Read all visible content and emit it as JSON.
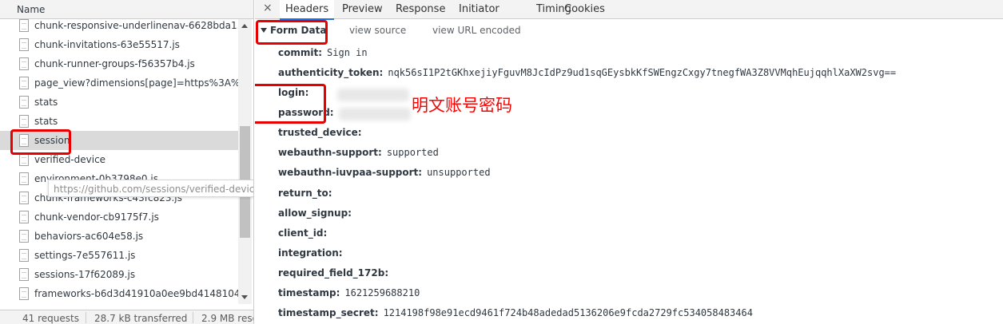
{
  "left": {
    "column_header": "Name",
    "requests": [
      {
        "label": "chunk-responsive-underlinenav-6628bda1.",
        "selected": false
      },
      {
        "label": "chunk-invitations-63e55517.js",
        "selected": false
      },
      {
        "label": "chunk-runner-groups-f56357b4.js",
        "selected": false
      },
      {
        "label": "page_view?dimensions[page]=https%3A%2",
        "selected": false
      },
      {
        "label": "stats",
        "selected": false
      },
      {
        "label": "stats",
        "selected": false
      },
      {
        "label": "session",
        "selected": true
      },
      {
        "label": "verified-device",
        "selected": false
      },
      {
        "label": "environment-0b3798e0.js",
        "selected": false
      },
      {
        "label": "chunk-frameworks-c43fc823.js",
        "selected": false
      },
      {
        "label": "chunk-vendor-cb9175f7.js",
        "selected": false
      },
      {
        "label": "behaviors-ac604e58.js",
        "selected": false
      },
      {
        "label": "settings-7e557611.js",
        "selected": false
      },
      {
        "label": "sessions-17f62089.js",
        "selected": false
      },
      {
        "label": "frameworks-b6d3d41910a0ee9bd4148104.",
        "selected": false
      }
    ],
    "tooltip": "https://github.com/sessions/verified-device",
    "status": {
      "requests": "41 requests",
      "transferred": "28.7 kB transferred",
      "resources": "2.9 MB reso"
    }
  },
  "right": {
    "close_glyph": "×",
    "tabs": [
      {
        "label": "Headers",
        "active": true
      },
      {
        "label": "Preview",
        "active": false
      },
      {
        "label": "Response",
        "active": false
      },
      {
        "label": "Initiator",
        "active": false
      },
      {
        "label": "Timing",
        "active": false
      },
      {
        "label": "Cookies",
        "active": false
      }
    ],
    "section": {
      "title": "Form Data",
      "view_source": "view source",
      "view_url_encoded": "view URL encoded"
    },
    "form_fields": [
      {
        "key": "commit:",
        "value": "Sign in"
      },
      {
        "key": "authenticity_token:",
        "value": "nqk56sI1P2tGKhxejiyFguvM8JcIdPz9ud1sqGEysbkKfSWEngzCxgy7tnegfWA3Z8VVMqhEujqqhlXaXW2svg=="
      },
      {
        "key": "login:",
        "value": ""
      },
      {
        "key": "password:",
        "value": ""
      },
      {
        "key": "trusted_device:",
        "value": ""
      },
      {
        "key": "webauthn-support:",
        "value": "supported"
      },
      {
        "key": "webauthn-iuvpaa-support:",
        "value": "unsupported"
      },
      {
        "key": "return_to:",
        "value": ""
      },
      {
        "key": "allow_signup:",
        "value": ""
      },
      {
        "key": "client_id:",
        "value": ""
      },
      {
        "key": "integration:",
        "value": ""
      },
      {
        "key": "required_field_172b:",
        "value": ""
      },
      {
        "key": "timestamp:",
        "value": "1621259688210"
      },
      {
        "key": "timestamp_secret:",
        "value": "1214198f98e91ecd9461f724b48adedad5136206e9fcda2729fc534058483464"
      }
    ],
    "annotation": "明文账号密码",
    "highlight_color": "#e60000"
  }
}
